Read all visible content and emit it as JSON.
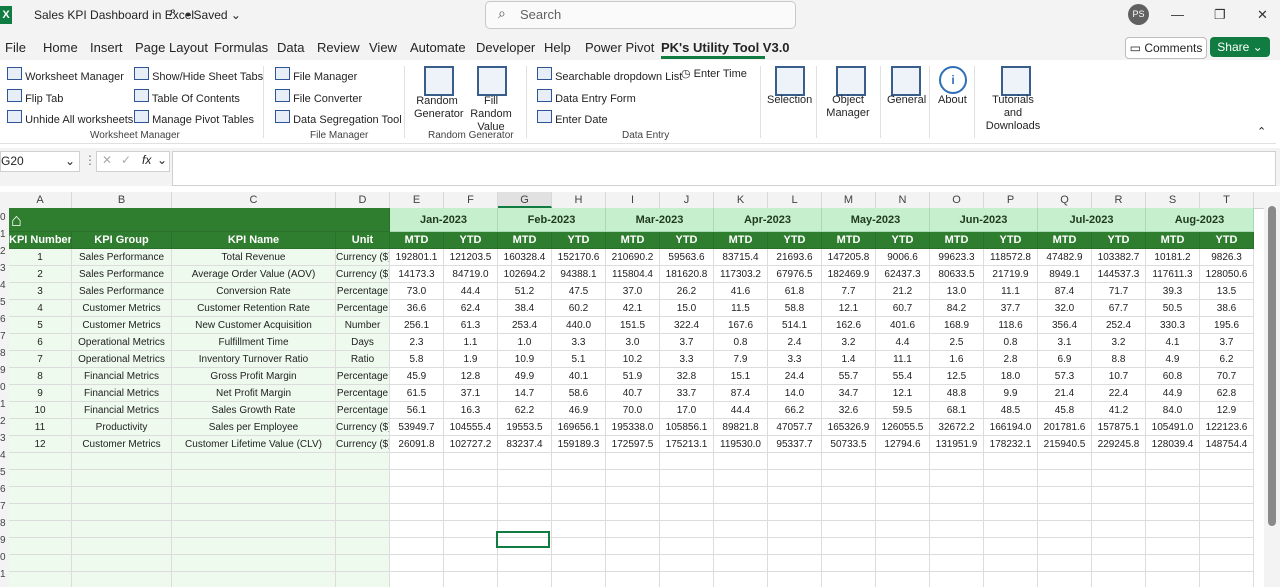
{
  "window": {
    "title": "Sales KPI Dashboard in Excel",
    "saved": "• Saved",
    "logo": "X",
    "avatar": "PS"
  },
  "search": {
    "placeholder": "Search"
  },
  "menu": {
    "tabs": [
      "File",
      "Home",
      "Insert",
      "Page Layout",
      "Formulas",
      "Data",
      "Review",
      "View",
      "Automate",
      "Developer",
      "Help",
      "Power Pivot",
      "PK's Utility Tool V3.0"
    ],
    "comments": "Comments",
    "share": "Share"
  },
  "ribbon": {
    "worksheet_manager": {
      "items": [
        "Worksheet Manager",
        "Flip Tab",
        "Unhide All worksheets",
        "Show/Hide Sheet Tabs",
        "Table Of Contents",
        "Manage Pivot Tables"
      ],
      "name": "Worksheet Manager"
    },
    "file_manager": {
      "items": [
        "File Manager",
        "File Converter",
        "Data Segregation Tool"
      ],
      "name": "File Manager"
    },
    "random_generator": {
      "items": [
        "Random Generator",
        "Fill Random Value"
      ],
      "name": "Random Generator"
    },
    "data_entry": {
      "items": [
        "Searchable dropdown List",
        "Data Entry Form",
        "Enter Date",
        "Enter Time"
      ],
      "name": "Data Entry"
    },
    "others": [
      "Selection",
      "Object Manager",
      "General",
      "About",
      "Tutorials and Downloads"
    ]
  },
  "formula_bar": {
    "name_box": "G20",
    "fx": "fx"
  },
  "sheet": {
    "columns": [
      "A",
      "B",
      "C",
      "D",
      "E",
      "F",
      "G",
      "H",
      "I",
      "J",
      "K",
      "L",
      "M",
      "N",
      "O",
      "P",
      "Q",
      "R",
      "S",
      "T"
    ],
    "months": [
      "Jan-2023",
      "Feb-2023",
      "Mar-2023",
      "Apr-2023",
      "May-2023",
      "Jun-2023",
      "Jul-2023",
      "Aug-2023"
    ],
    "headers": [
      "KPI Number",
      "KPI Group",
      "KPI Name",
      "Unit"
    ],
    "sub_headers": [
      "MTD",
      "YTD"
    ],
    "rows": [
      {
        "n": "1",
        "group": "Sales Performance",
        "name": "Total Revenue",
        "unit": "Currency ($)",
        "vals": [
          "192801.1",
          "121203.5",
          "160328.4",
          "152170.6",
          "210690.2",
          "59563.6",
          "83715.4",
          "21693.6",
          "147205.8",
          "9006.6",
          "99623.3",
          "118572.8",
          "47482.9",
          "103382.7",
          "10181.2",
          "9826.3"
        ]
      },
      {
        "n": "2",
        "group": "Sales Performance",
        "name": "Average Order Value (AOV)",
        "unit": "Currency ($)",
        "vals": [
          "14173.3",
          "84719.0",
          "102694.2",
          "94388.1",
          "115804.4",
          "181620.8",
          "117303.2",
          "67976.5",
          "182469.9",
          "62437.3",
          "80633.5",
          "21719.9",
          "8949.1",
          "144537.3",
          "117611.3",
          "128050.6"
        ]
      },
      {
        "n": "3",
        "group": "Sales Performance",
        "name": "Conversion Rate",
        "unit": "Percentage",
        "vals": [
          "73.0",
          "44.4",
          "51.2",
          "47.5",
          "37.0",
          "26.2",
          "41.6",
          "61.8",
          "7.7",
          "21.2",
          "13.0",
          "11.1",
          "87.4",
          "71.7",
          "39.3",
          "13.5"
        ]
      },
      {
        "n": "4",
        "group": "Customer Metrics",
        "name": "Customer Retention Rate",
        "unit": "Percentage",
        "vals": [
          "36.6",
          "62.4",
          "38.4",
          "60.2",
          "42.1",
          "15.0",
          "11.5",
          "58.8",
          "12.1",
          "60.7",
          "84.2",
          "37.7",
          "32.0",
          "67.7",
          "50.5",
          "38.6"
        ]
      },
      {
        "n": "5",
        "group": "Customer Metrics",
        "name": "New Customer Acquisition",
        "unit": "Number",
        "vals": [
          "256.1",
          "61.3",
          "253.4",
          "440.0",
          "151.5",
          "322.4",
          "167.6",
          "514.1",
          "162.6",
          "401.6",
          "168.9",
          "118.6",
          "356.4",
          "252.4",
          "330.3",
          "195.6"
        ]
      },
      {
        "n": "6",
        "group": "Operational Metrics",
        "name": "Fulfillment Time",
        "unit": "Days",
        "vals": [
          "2.3",
          "1.1",
          "1.0",
          "3.3",
          "3.0",
          "3.7",
          "0.8",
          "2.4",
          "3.2",
          "4.4",
          "2.5",
          "0.8",
          "3.1",
          "3.2",
          "4.1",
          "3.7"
        ]
      },
      {
        "n": "7",
        "group": "Operational Metrics",
        "name": "Inventory Turnover Ratio",
        "unit": "Ratio",
        "vals": [
          "5.8",
          "1.9",
          "10.9",
          "5.1",
          "10.2",
          "3.3",
          "7.9",
          "3.3",
          "1.4",
          "11.1",
          "1.6",
          "2.8",
          "6.9",
          "8.8",
          "4.9",
          "6.2"
        ]
      },
      {
        "n": "8",
        "group": "Financial Metrics",
        "name": "Gross Profit Margin",
        "unit": "Percentage",
        "vals": [
          "45.9",
          "12.8",
          "49.9",
          "40.1",
          "51.9",
          "32.8",
          "15.1",
          "24.4",
          "55.7",
          "55.4",
          "12.5",
          "18.0",
          "57.3",
          "10.7",
          "60.8",
          "70.7"
        ]
      },
      {
        "n": "9",
        "group": "Financial Metrics",
        "name": "Net Profit Margin",
        "unit": "Percentage",
        "vals": [
          "61.5",
          "37.1",
          "14.7",
          "58.6",
          "40.7",
          "33.7",
          "87.4",
          "14.0",
          "34.7",
          "12.1",
          "48.8",
          "9.9",
          "21.4",
          "22.4",
          "44.9",
          "62.8"
        ]
      },
      {
        "n": "10",
        "group": "Financial Metrics",
        "name": "Sales Growth Rate",
        "unit": "Percentage",
        "vals": [
          "56.1",
          "16.3",
          "62.2",
          "46.9",
          "70.0",
          "17.0",
          "44.4",
          "66.2",
          "32.6",
          "59.5",
          "68.1",
          "48.5",
          "45.8",
          "41.2",
          "84.0",
          "12.9"
        ]
      },
      {
        "n": "11",
        "group": "Productivity",
        "name": "Sales per Employee",
        "unit": "Currency ($)",
        "vals": [
          "53949.7",
          "104555.4",
          "19553.5",
          "169656.1",
          "195338.0",
          "105856.1",
          "89821.8",
          "47057.7",
          "165326.9",
          "126055.5",
          "32672.2",
          "166194.0",
          "201781.6",
          "157875.1",
          "105491.0",
          "122123.6"
        ]
      },
      {
        "n": "12",
        "group": "Customer Metrics",
        "name": "Customer Lifetime Value (CLV)",
        "unit": "Currency ($)",
        "vals": [
          "26091.8",
          "102727.2",
          "83237.4",
          "159189.3",
          "172597.5",
          "175213.1",
          "119530.0",
          "95337.7",
          "50733.5",
          "12794.6",
          "131951.9",
          "178232.1",
          "215940.5",
          "229245.8",
          "128039.4",
          "148754.4"
        ]
      }
    ],
    "row_numbers": [
      "0",
      "1",
      "2",
      "3",
      "4",
      "5",
      "6",
      "7",
      "8",
      "9",
      "0",
      "1",
      "2",
      "3",
      "4",
      "5",
      "6",
      "7",
      "8",
      "9",
      "0",
      "1"
    ]
  },
  "colors": {
    "dark_green": "#2f7d2f",
    "light_green": "#c6efce",
    "excel_green": "#107c41"
  }
}
